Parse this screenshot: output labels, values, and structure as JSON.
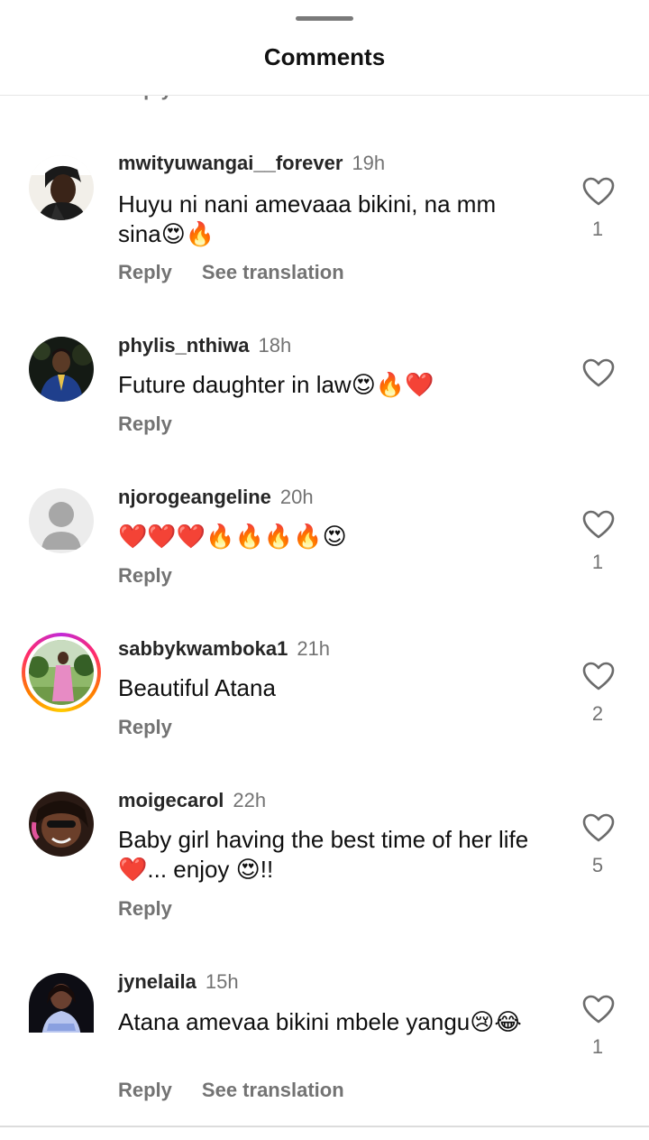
{
  "header": {
    "title": "Comments",
    "partial_reply": "Reply"
  },
  "comments": [
    {
      "username": "mwityuwangai__forever",
      "time": "19h",
      "text": "Huyu ni nani amevaaa bikini, na mm sina😍🔥",
      "reply_label": "Reply",
      "translate_label": "See translation",
      "likes": "1",
      "avatar_icon": "profile-photo"
    },
    {
      "username": "phylis_nthiwa",
      "time": "18h",
      "text": "Future daughter in law😍🔥❤️",
      "reply_label": "Reply",
      "avatar_icon": "profile-photo"
    },
    {
      "username": "njorogeangeline",
      "time": "20h",
      "text": "❤️❤️❤️🔥🔥🔥🔥😍",
      "reply_label": "Reply",
      "likes": "1",
      "avatar_icon": "default-person-icon"
    },
    {
      "username": "sabbykwamboka1",
      "time": "21h",
      "text": "Beautiful Atana",
      "reply_label": "Reply",
      "likes": "2",
      "avatar_icon": "story-ring-photo"
    },
    {
      "username": "moigecarol",
      "time": "22h",
      "text": "Baby girl having the best time of her life ❤️... enjoy 😍!!",
      "reply_label": "Reply",
      "likes": "5",
      "avatar_icon": "profile-photo"
    },
    {
      "username": "jynelaila",
      "time": "15h",
      "text": "Atana amevaa bikini mbele yangu😢😂",
      "reply_label": "Reply",
      "translate_label": "See translation",
      "likes": "1",
      "avatar_icon": "profile-photo"
    }
  ],
  "colors": {
    "secondary_text": "#737373",
    "username": "#262626",
    "divider": "#e6e6e6"
  }
}
